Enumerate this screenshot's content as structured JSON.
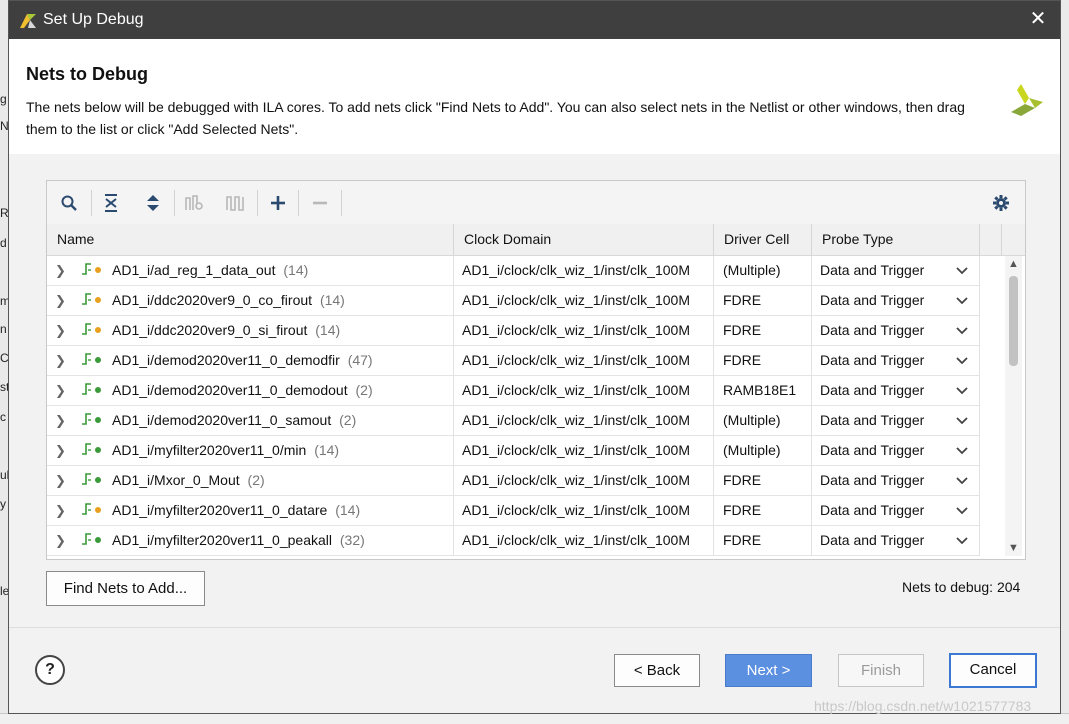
{
  "window": {
    "title": "Set Up Debug",
    "close_glyph": "✕"
  },
  "header": {
    "title": "Nets to Debug",
    "description": "The nets below will be debugged with ILA cores. To add nets click \"Find Nets to Add\". You can also select nets in the Netlist or other windows, then drag them to the list or click \"Add Selected Nets\"."
  },
  "toolbar": {
    "icons": [
      "search-icon",
      "collapse-all-icon",
      "expand-all-icon",
      "group-icon",
      "waveform-icon",
      "add-icon",
      "remove-icon",
      "settings-icon"
    ]
  },
  "table": {
    "columns": [
      "Name",
      "Clock Domain",
      "Driver Cell",
      "Probe Type"
    ],
    "rows": [
      {
        "name": "AD1_i/ad_reg_1_data_out",
        "count": "(14)",
        "clock": "AD1_i/clock/clk_wiz_1/inst/clk_100M",
        "driver": "(Multiple)",
        "probe": "Data and Trigger",
        "dot": "#e8a020"
      },
      {
        "name": "AD1_i/ddc2020ver9_0_co_firout",
        "count": "(14)",
        "clock": "AD1_i/clock/clk_wiz_1/inst/clk_100M",
        "driver": "FDRE",
        "probe": "Data and Trigger",
        "dot": "#e8a020"
      },
      {
        "name": "AD1_i/ddc2020ver9_0_si_firout",
        "count": "(14)",
        "clock": "AD1_i/clock/clk_wiz_1/inst/clk_100M",
        "driver": "FDRE",
        "probe": "Data and Trigger",
        "dot": "#e8a020"
      },
      {
        "name": "AD1_i/demod2020ver11_0_demodfir",
        "count": "(47)",
        "clock": "AD1_i/clock/clk_wiz_1/inst/clk_100M",
        "driver": "FDRE",
        "probe": "Data and Trigger",
        "dot": "#3a9a3a"
      },
      {
        "name": "AD1_i/demod2020ver11_0_demodout",
        "count": "(2)",
        "clock": "AD1_i/clock/clk_wiz_1/inst/clk_100M",
        "driver": "RAMB18E1",
        "probe": "Data and Trigger",
        "dot": "#3a9a3a"
      },
      {
        "name": "AD1_i/demod2020ver11_0_samout",
        "count": "(2)",
        "clock": "AD1_i/clock/clk_wiz_1/inst/clk_100M",
        "driver": "(Multiple)",
        "probe": "Data and Trigger",
        "dot": "#3a9a3a"
      },
      {
        "name": "AD1_i/myfilter2020ver11_0/min",
        "count": "(14)",
        "clock": "AD1_i/clock/clk_wiz_1/inst/clk_100M",
        "driver": "(Multiple)",
        "probe": "Data and Trigger",
        "dot": "#3a9a3a"
      },
      {
        "name": "AD1_i/Mxor_0_Mout",
        "count": "(2)",
        "clock": "AD1_i/clock/clk_wiz_1/inst/clk_100M",
        "driver": "FDRE",
        "probe": "Data and Trigger",
        "dot": "#3a9a3a"
      },
      {
        "name": "AD1_i/myfilter2020ver11_0_datare",
        "count": "(14)",
        "clock": "AD1_i/clock/clk_wiz_1/inst/clk_100M",
        "driver": "FDRE",
        "probe": "Data and Trigger",
        "dot": "#e8a020"
      },
      {
        "name": "AD1_i/myfilter2020ver11_0_peakall",
        "count": "(32)",
        "clock": "AD1_i/clock/clk_wiz_1/inst/clk_100M",
        "driver": "FDRE",
        "probe": "Data and Trigger",
        "dot": "#3a9a3a"
      }
    ]
  },
  "find_nets_label": "Find Nets to Add...",
  "nets_count": "Nets to debug: 204",
  "footer": {
    "help_label": "?",
    "back_label": "< Back",
    "next_label": "Next >",
    "finish_label": "Finish",
    "cancel_label": "Cancel"
  },
  "watermark": "https://blog.csdn.net/w1021577783",
  "background_fragments": [
    "g",
    "N",
    "R",
    "d",
    "m",
    "n",
    "C",
    "st",
    "c",
    "ul",
    "y",
    "le"
  ],
  "colors": {
    "titlebar": "#3f3f3f",
    "primary_button": "#5b8fe0",
    "focus_border": "#3a78d4"
  }
}
